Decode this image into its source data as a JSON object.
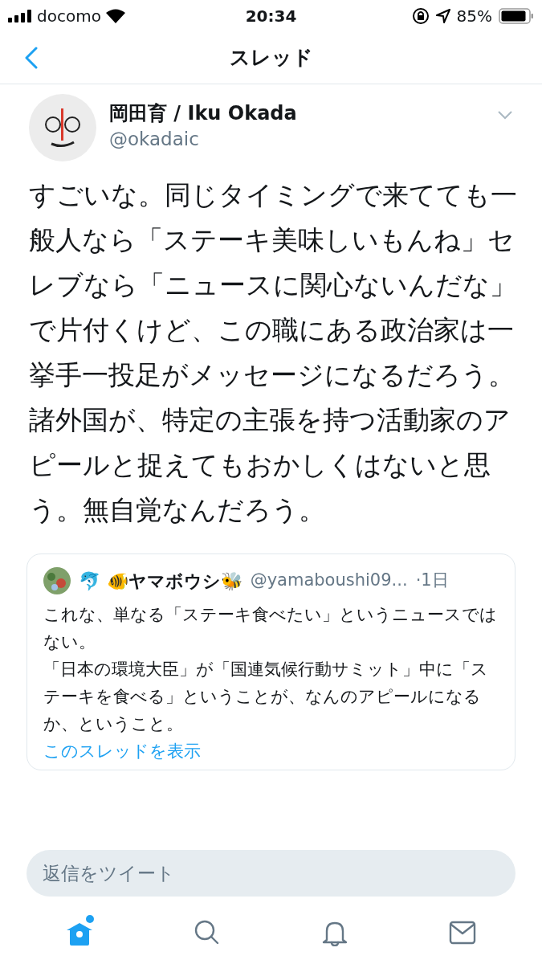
{
  "status_bar": {
    "carrier": "docomo",
    "time": "20:34",
    "battery": "85%"
  },
  "nav": {
    "title": "スレッド"
  },
  "tweet": {
    "name": "岡田育 / Iku Okada",
    "handle": "@okadaic",
    "text": "すごいな。同じタイミングで来てても一般人なら「ステーキ美味しいもんね」セレブなら「ニュースに関心ないんだな」で片付くけど、この職にある政治家は一挙手一投足がメッセージになるだろう。諸外国が、特定の主張を持つ活動家のアピールと捉えてもおかしくはないと思う。無自覚なんだろう。"
  },
  "quoted_tweet": {
    "name": "🐬 🐠ヤマボウシ🐝",
    "handle": "@yamaboushi09...",
    "time": "·1日",
    "lines": [
      "これな、単なる「ステーキ食べたい」というニュースではない。",
      "「日本の環境大臣」が「国連気候行動サミット」中に「ステーキを食べる」ということが、なんのアピールになるか、ということ。"
    ],
    "link": "このスレッドを表示"
  },
  "reply_field": {
    "placeholder": "返信をツイート"
  },
  "tab_bar": [
    {
      "kind": "home",
      "selected": true,
      "badge": true
    },
    {
      "kind": "search",
      "selected": false,
      "badge": false
    },
    {
      "kind": "notifications",
      "selected": false,
      "badge": false
    },
    {
      "kind": "messages",
      "selected": false,
      "badge": false
    }
  ]
}
